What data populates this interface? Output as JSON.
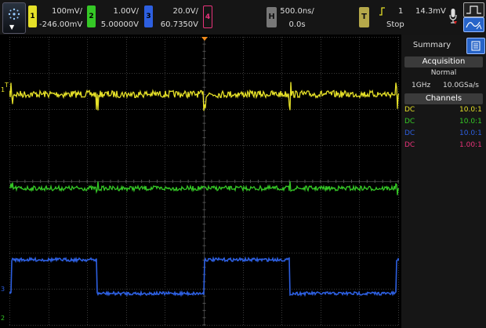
{
  "colors": {
    "ch1": "#e5e028",
    "ch2": "#35c826",
    "ch3": "#2d5fe0",
    "ch4": "#e8337a",
    "trigger": "#f08a1a"
  },
  "topbar": {
    "ch1": {
      "num": "1",
      "scale": "100mV/",
      "offset": "-246.00mV"
    },
    "ch2": {
      "num": "2",
      "scale": "1.00V/",
      "offset": "5.00000V"
    },
    "ch3": {
      "num": "3",
      "scale": "20.0V/",
      "offset": "60.7350V"
    },
    "ch4": {
      "num": "4"
    },
    "horizontal": {
      "label": "H",
      "scale": "500.0ns/",
      "delay": "0.0s"
    },
    "trigger": {
      "label": "T",
      "source": "1",
      "level": "14.3mV",
      "status": "Stop"
    }
  },
  "panel": {
    "title": "Summary",
    "acquisition": {
      "header": "Acquisition",
      "mode": "Normal",
      "bandwidth": "1GHz",
      "rate": "10.0GSa/s"
    },
    "channels": {
      "header": "Channels",
      "rows": [
        {
          "coupling": "DC",
          "probe": "10.0:1",
          "color": "#e5e028"
        },
        {
          "coupling": "DC",
          "probe": "10.0:1",
          "color": "#35c826"
        },
        {
          "coupling": "DC",
          "probe": "10.0:1",
          "color": "#2d5fe0"
        },
        {
          "coupling": "DC",
          "probe": "1.00:1",
          "color": "#e8337a"
        }
      ]
    }
  },
  "markers": {
    "ch1": "1",
    "ch2": "2",
    "ch3": "3"
  },
  "icons": {
    "menu": "run-menu-icon",
    "mic": "microphone-icon",
    "wave": "waveform-icon",
    "summary_menu": "list-menu-icon"
  }
}
